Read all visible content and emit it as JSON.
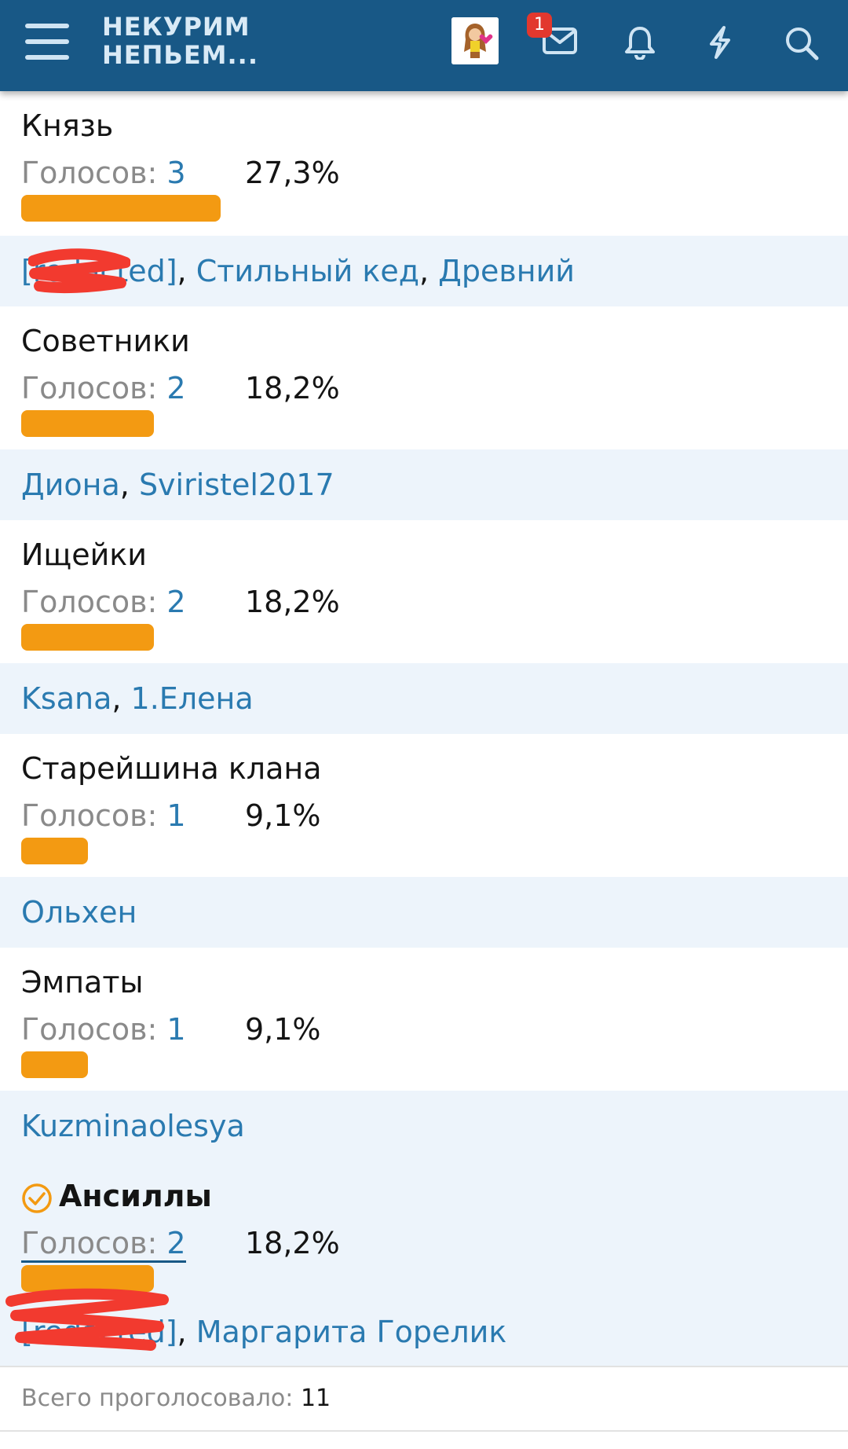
{
  "header": {
    "logo_line1": "НЕКУРИМ",
    "logo_line2": "НЕПЬЕМ...",
    "inbox_badge": "1",
    "icons": [
      "menu-icon",
      "avatar",
      "envelope-icon",
      "bell-icon",
      "lightning-icon",
      "search-icon"
    ],
    "colors": {
      "bar": "#185886",
      "badge": "#e2382e"
    }
  },
  "poll": {
    "votes_label": "Голосов:",
    "options": [
      {
        "name": "Князь",
        "votes": "3",
        "percent": "27,3%",
        "fraction": 0.273,
        "voters": [
          "[redacted]",
          "Стильный кед",
          "Древний"
        ]
      },
      {
        "name": "Советники",
        "votes": "2",
        "percent": "18,2%",
        "fraction": 0.182,
        "voters": [
          "Диона",
          "Sviristel2017"
        ]
      },
      {
        "name": "Ищейки",
        "votes": "2",
        "percent": "18,2%",
        "fraction": 0.182,
        "voters": [
          "Ksana",
          "1.Елена"
        ]
      },
      {
        "name": "Старейшина клана",
        "votes": "1",
        "percent": "9,1%",
        "fraction": 0.091,
        "voters": [
          "Ольхен"
        ]
      },
      {
        "name": "Эмпаты",
        "votes": "1",
        "percent": "9,1%",
        "fraction": 0.091,
        "voters": [
          "Kuzminaolesya"
        ]
      },
      {
        "name": "Ансиллы",
        "votes": "2",
        "percent": "18,2%",
        "fraction": 0.182,
        "selected": true,
        "voters": [
          "[redacted]",
          "Маргарита Горелик"
        ]
      }
    ],
    "total_label": "Всего проголосовало:",
    "total": "11",
    "colors": {
      "bar": "#f39a12",
      "link": "#2a7ab0",
      "voters_bg": "#edf4fb",
      "check": "#f39a12"
    }
  }
}
